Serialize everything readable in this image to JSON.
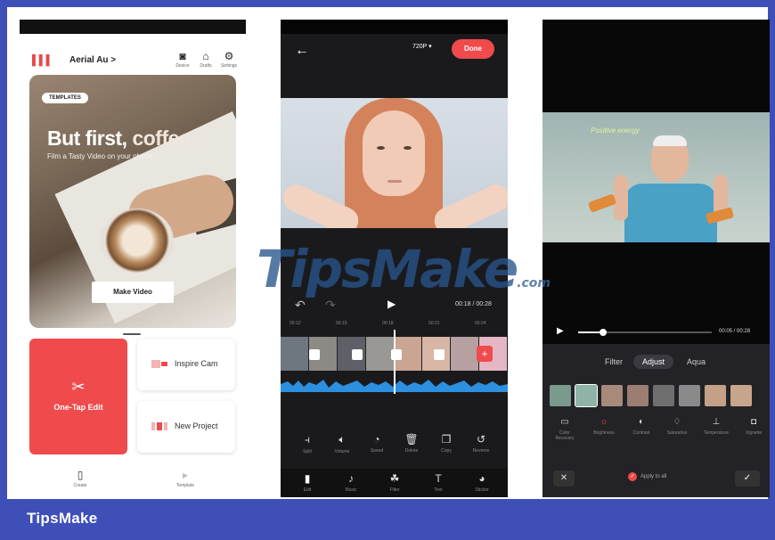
{
  "watermark": {
    "main": "TipsMake",
    "suffix": ".com"
  },
  "footer": {
    "brand": "TipsMake"
  },
  "phone1": {
    "account": "Aerial Au >",
    "top_icons": [
      {
        "icon": "camera-icon",
        "label": "Device"
      },
      {
        "icon": "drafts-icon",
        "label": "Drafts"
      },
      {
        "icon": "gear-icon",
        "label": "Settings"
      }
    ],
    "hero": {
      "badge": "TEMPLATES",
      "title_part1": "But first,",
      "title_part2": " coffee.",
      "subtitle": "Film a Tasty Video on your phone",
      "button": "Make Video"
    },
    "one_tap": "One-Tap Edit",
    "inspire_cam": "Inspire Cam",
    "new_project": "New Project",
    "nav": [
      {
        "icon": "create-icon",
        "label": "Create"
      },
      {
        "icon": "template-icon",
        "label": "Template"
      }
    ]
  },
  "phone2": {
    "resolution": "720P ▾",
    "done": "Done",
    "timecode": "00:18 / 00:28",
    "ruler": [
      "00:12",
      "00:15",
      "00:18",
      "00:21",
      "00:24"
    ],
    "tools": [
      {
        "icon": "split-icon",
        "label": "Split"
      },
      {
        "icon": "volume-icon",
        "label": "Volume"
      },
      {
        "icon": "speed-icon",
        "label": "Speed"
      },
      {
        "icon": "delete-icon",
        "label": "Delete"
      },
      {
        "icon": "copy-icon",
        "label": "Copy"
      },
      {
        "icon": "reverse-icon",
        "label": "Reverse"
      }
    ],
    "nav": [
      {
        "icon": "edit-icon",
        "label": "Edit"
      },
      {
        "icon": "music-icon",
        "label": "Music"
      },
      {
        "icon": "filter-icon",
        "label": "Filter"
      },
      {
        "icon": "text-icon",
        "label": "Text"
      },
      {
        "icon": "sticker-icon",
        "label": "Sticker"
      }
    ]
  },
  "phone3": {
    "caption": "Positive energy",
    "timecode": "00:05 / 00:28",
    "progress": 0.18,
    "tabs": [
      "Filter",
      "Adjust",
      "Aqua"
    ],
    "adjust_tools": [
      {
        "icon": "color-recovery-icon",
        "label": "Color Recovery"
      },
      {
        "icon": "brightness-icon",
        "label": "Brightness"
      },
      {
        "icon": "contrast-icon",
        "label": "Contrast"
      },
      {
        "icon": "saturation-icon",
        "label": "Saturation"
      },
      {
        "icon": "temperature-icon",
        "label": "Temperature"
      },
      {
        "icon": "vignette-icon",
        "label": "Vignette"
      }
    ],
    "apply_all": "Apply to all",
    "colors": {
      "accent": "#ef4a4c",
      "panel": "#232327"
    }
  }
}
